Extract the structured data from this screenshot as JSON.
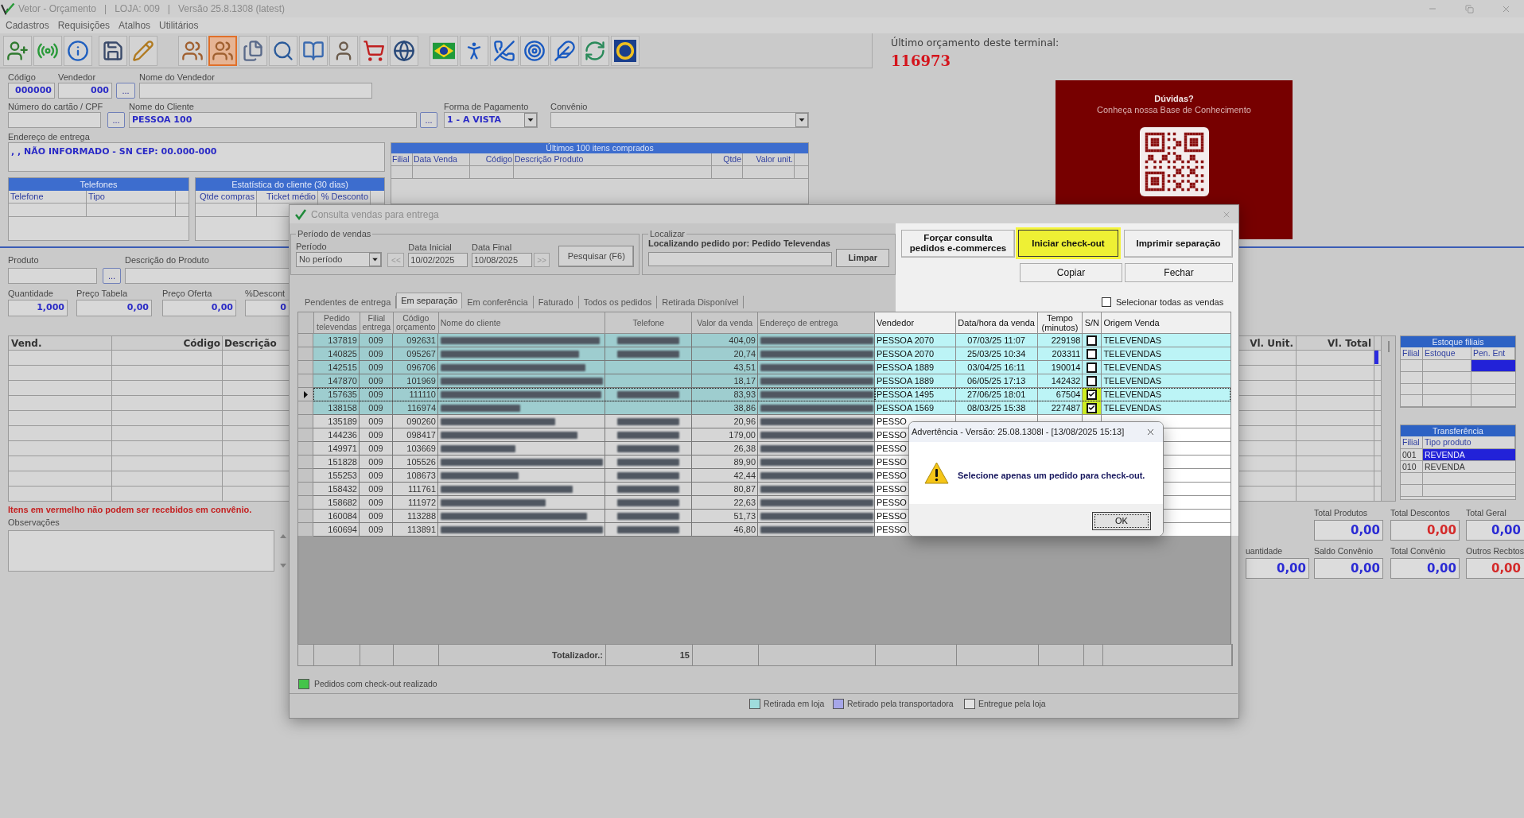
{
  "window": {
    "title": "Vetor - Orçamento   |   LOJA: 009   |   Versão 25.8.1308 (latest)"
  },
  "menu": [
    "Cadastros",
    "Requisições",
    "Atalhos",
    "Utilitários"
  ],
  "toolbar": [
    {
      "buttons": [
        {
          "selected": false
        },
        {
          "selected": false
        },
        {
          "selected": false
        }
      ]
    },
    {
      "buttons": [
        {
          "selected": false
        },
        {
          "selected": false
        }
      ]
    },
    {
      "buttons": [
        {
          "selected": false
        },
        {
          "selected": true
        },
        {
          "selected": false
        },
        {
          "selected": false
        },
        {
          "selected": false
        },
        {
          "selected": false
        },
        {
          "selected": false
        },
        {
          "selected": false
        }
      ]
    },
    {
      "buttons": [
        {
          "selected": false
        },
        {
          "selected": false
        },
        {
          "selected": false
        },
        {
          "selected": false
        },
        {
          "selected": false
        },
        {
          "selected": false
        },
        {
          "selected": false
        }
      ]
    }
  ],
  "last_budget": {
    "label": "Último orçamento deste terminal:",
    "number": "116973"
  },
  "help_card": {
    "title": "Dúvidas?",
    "subtitle": "Conheça nossa Base de Conhecimento"
  },
  "header_form": {
    "codigo": {
      "label": "Código",
      "value": "000000"
    },
    "vendedor": {
      "label": "Vendedor",
      "value": "000",
      "button": "..."
    },
    "nome_vendedor": {
      "label": "Nome do Vendedor"
    },
    "cartao": {
      "label": "Número do cartão / CPF",
      "button": "..."
    },
    "cliente": {
      "label": "Nome do Cliente",
      "value": "PESSOA 100",
      "button": "..."
    },
    "pagamento": {
      "label": "Forma de Pagamento",
      "value": "1 - A VISTA"
    },
    "convenio": {
      "label": "Convênio"
    },
    "endereco": {
      "label": "Endereço de entrega",
      "value": ", , NÃO INFORMADO - SN CEP: 00.000-000"
    }
  },
  "last_items": {
    "title": "Últimos 100 itens comprados",
    "columns": [
      "Filial",
      "Data Venda",
      "Código",
      "Descrição Produto",
      "Qtde",
      "Valor unit."
    ]
  },
  "phones": {
    "title": "Telefones",
    "columns": [
      "Telefone",
      "Tipo"
    ]
  },
  "stats": {
    "title": "Estatística do cliente (30 dias)",
    "columns": [
      "Qtde compras",
      "Ticket médio",
      "% Desconto"
    ]
  },
  "product_form": {
    "produto": {
      "label": "Produto",
      "button": "..."
    },
    "descricao": {
      "label": "Descrição do Produto"
    },
    "quantidade": {
      "label": "Quantidade",
      "value": "1,000"
    },
    "preco_tabela": {
      "label": "Preço Tabela",
      "value": "0,00"
    },
    "preco_oferta": {
      "label": "Preço Oferta",
      "value": "0,00"
    },
    "desconto": {
      "label": "%Descont",
      "value": "0"
    }
  },
  "items_table": {
    "columns": [
      "Vend.",
      "Código",
      "Descrição",
      "Vl. Unit.",
      "Vl. Total"
    ]
  },
  "notice": "Itens em vermelho não podem ser recebidos em convênio.",
  "observacoes": {
    "label": "Observações"
  },
  "estoque": {
    "title": "Estoque filiais",
    "columns": [
      "Filial",
      "Estoque",
      "Pen. Ent"
    ],
    "rows": [
      {
        "selected": true
      }
    ]
  },
  "transferencia": {
    "title": "Transferência",
    "columns": [
      "Filial",
      "Tipo produto"
    ],
    "rows": [
      {
        "filial": "001",
        "tipo": "REVENDA",
        "selected": true
      },
      {
        "filial": "010",
        "tipo": "REVENDA",
        "selected": false
      }
    ]
  },
  "totals": {
    "row_1": [
      {
        "label": "Total Produtos",
        "value": "0,00",
        "color": "#2a2ad4"
      },
      {
        "label": "Total Descontos",
        "value": "0,00",
        "color": "#d42a2a"
      },
      {
        "label": "Total Geral",
        "value": "0,00",
        "color": "#2a2ad4"
      }
    ],
    "row_2": [
      {
        "label": "uantidade",
        "value": "0,00",
        "color": "#2a2ad4"
      },
      {
        "label": "Saldo Convênio",
        "value": "0,00",
        "color": "#2a2ad4"
      },
      {
        "label": "Total Convênio",
        "value": "0,00",
        "color": "#2a2ad4"
      },
      {
        "label": "Outros Recbtos",
        "value": "0,00",
        "color": "#d42a2a"
      }
    ]
  },
  "dialog": {
    "title": "Consulta vendas para entrega",
    "period_group": {
      "title": "Período de vendas",
      "period_label": "Período",
      "period_value": "No período",
      "prev_button": "<<",
      "start_label": "Data Inicial",
      "start_value": "10/02/2025",
      "end_label": "Data Final",
      "end_value": "10/08/2025",
      "next_button": ">>",
      "search_button": "Pesquisar (F6)"
    },
    "locate_group": {
      "title": "Localizar",
      "caption": "Localizando pedido por: Pedido Televendas",
      "clear_button": "Limpar"
    },
    "actions": [
      {
        "lines": [
          "Forçar consulta",
          "pedidos e-commerces"
        ],
        "highlighted": false
      },
      {
        "lines": [
          "Iniciar check-out"
        ],
        "highlighted": true
      },
      {
        "lines": [
          "Imprimir separação"
        ],
        "highlighted": false
      }
    ],
    "secondary_actions": [
      "Copiar",
      "Fechar"
    ],
    "select_all": {
      "label": "Selecionar todas as vendas",
      "checked": false
    },
    "tabs": [
      {
        "label": "Pendentes de entrega",
        "selected": false
      },
      {
        "label": "Em separação",
        "selected": true
      },
      {
        "label": "Em conferência",
        "selected": false
      },
      {
        "label": "Faturado",
        "selected": false
      },
      {
        "label": "Todos os pedidos",
        "selected": false
      },
      {
        "label": "Retirada Disponível",
        "selected": false
      }
    ],
    "columns": [
      "Pedido televendas",
      "Filial entrega",
      "Código orçamento",
      "Nome do cliente",
      "Telefone",
      "Valor da venda",
      "Endereço de entrega",
      "Vendedor",
      "Data/hora da venda",
      "Tempo (minutos)",
      "S/N",
      "Origem Venda"
    ],
    "rows": [
      {
        "pedido": "137819",
        "filial": "009",
        "codigo": "092631",
        "phone_shown": true,
        "valor": "404,09",
        "vendedor": "PESSOA 2070",
        "data_hora": "07/03/25 11:07",
        "tempo": "229198",
        "checked": false,
        "highlighted": false,
        "origem": "TELEVENDAS",
        "color": "#bcf4f6",
        "current": false
      },
      {
        "pedido": "140825",
        "filial": "009",
        "codigo": "095267",
        "phone_shown": true,
        "valor": "20,74",
        "vendedor": "PESSOA 2070",
        "data_hora": "25/03/25 10:34",
        "tempo": "203311",
        "checked": false,
        "highlighted": false,
        "origem": "TELEVENDAS",
        "color": "#bcf4f6",
        "current": false
      },
      {
        "pedido": "142515",
        "filial": "009",
        "codigo": "096706",
        "phone_shown": false,
        "valor": "43,51",
        "vendedor": "PESSOA 1889",
        "data_hora": "03/04/25 16:11",
        "tempo": "190014",
        "checked": false,
        "highlighted": false,
        "origem": "TELEVENDAS",
        "color": "#bcf4f6",
        "current": false
      },
      {
        "pedido": "147870",
        "filial": "009",
        "codigo": "101969",
        "phone_shown": false,
        "valor": "18,17",
        "vendedor": "PESSOA 1889",
        "data_hora": "06/05/25 17:13",
        "tempo": "142432",
        "checked": false,
        "highlighted": false,
        "origem": "TELEVENDAS",
        "color": "#bcf4f6",
        "current": false
      },
      {
        "pedido": "157635",
        "filial": "009",
        "codigo": "111110",
        "phone_shown": true,
        "valor": "83,93",
        "vendedor": "PESSOA 1495",
        "data_hora": "27/06/25 18:01",
        "tempo": "67504",
        "checked": true,
        "highlighted": true,
        "origem": "TELEVENDAS",
        "color": "#bcf4f6",
        "current": true
      },
      {
        "pedido": "138158",
        "filial": "009",
        "codigo": "116974",
        "phone_shown": false,
        "valor": "38,86",
        "vendedor": "PESSOA 1569",
        "data_hora": "08/03/25 15:38",
        "tempo": "227487",
        "checked": true,
        "highlighted": true,
        "origem": "TELEVENDAS",
        "color": "#bcf4f6",
        "current": false
      },
      {
        "pedido": "135189",
        "filial": "009",
        "codigo": "090260",
        "phone_shown": true,
        "valor": "20,96",
        "vendedor": "PESSO",
        "color": "#ffffff",
        "current": false
      },
      {
        "pedido": "144236",
        "filial": "009",
        "codigo": "098417",
        "phone_shown": true,
        "valor": "179,00",
        "vendedor": "PESSO",
        "color": "#ffffff",
        "current": false
      },
      {
        "pedido": "149971",
        "filial": "009",
        "codigo": "103669",
        "phone_shown": true,
        "valor": "26,38",
        "vendedor": "PESSO",
        "color": "#ffffff",
        "current": false
      },
      {
        "pedido": "151828",
        "filial": "009",
        "codigo": "105526",
        "phone_shown": true,
        "valor": "89,90",
        "vendedor": "PESSO",
        "color": "#ffffff",
        "current": false
      },
      {
        "pedido": "155253",
        "filial": "009",
        "codigo": "108673",
        "phone_shown": true,
        "valor": "42,44",
        "vendedor": "PESSO",
        "color": "#ffffff",
        "current": false
      },
      {
        "pedido": "158432",
        "filial": "009",
        "codigo": "111761",
        "phone_shown": true,
        "valor": "80,87",
        "vendedor": "PESSO",
        "color": "#ffffff",
        "current": false
      },
      {
        "pedido": "158682",
        "filial": "009",
        "codigo": "111972",
        "phone_shown": true,
        "valor": "22,63",
        "vendedor": "PESSO",
        "color": "#ffffff",
        "current": false
      },
      {
        "pedido": "160084",
        "filial": "009",
        "codigo": "113288",
        "phone_shown": true,
        "valor": "51,73",
        "vendedor": "PESSO",
        "color": "#ffffff",
        "current": false
      },
      {
        "pedido": "160694",
        "filial": "009",
        "codigo": "113891",
        "phone_shown": true,
        "valor": "46,80",
        "vendedor": "PESSO",
        "color": "#ffffff",
        "current": false
      }
    ],
    "totals": {
      "label": "Totalizador.:",
      "count": "15"
    },
    "legend_checkout": {
      "label": "Pedidos com check-out realizado",
      "color": "#44c44a"
    },
    "legend": [
      {
        "label": "Retirada em loja",
        "color": "#9fdcdc"
      },
      {
        "label": "Retirado pela transportadora",
        "color": "#a6a6e8"
      },
      {
        "label": "Entregue pela loja",
        "color": "#e2e2e2"
      }
    ]
  },
  "warning": {
    "title": "Advertência - Versão: 25.08.1308l - [13/08/2025 15:13]",
    "message": "Selecione apenas um pedido para check-out.",
    "button": "OK"
  }
}
